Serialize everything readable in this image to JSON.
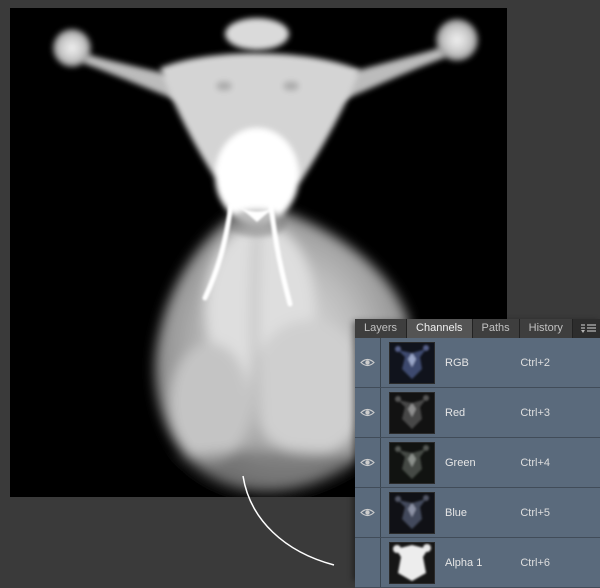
{
  "panel": {
    "tabs": [
      {
        "label": "Layers"
      },
      {
        "label": "Channels"
      },
      {
        "label": "Paths"
      },
      {
        "label": "History"
      }
    ],
    "active_tab": "Channels",
    "channels": [
      {
        "name": "RGB",
        "shortcut": "Ctrl+2",
        "visible": true,
        "selected": true
      },
      {
        "name": "Red",
        "shortcut": "Ctrl+3",
        "visible": true,
        "selected": true
      },
      {
        "name": "Green",
        "shortcut": "Ctrl+4",
        "visible": true,
        "selected": true
      },
      {
        "name": "Blue",
        "shortcut": "Ctrl+5",
        "visible": true,
        "selected": true
      },
      {
        "name": "Alpha 1",
        "shortcut": "Ctrl+6",
        "visible": false,
        "selected": true
      }
    ]
  },
  "canvas": {
    "image_alt": "Grayscale depth-map render of a horned creature on a black background"
  },
  "colors": {
    "workspace_bg": "#3a3a3a",
    "canvas_bg": "#000000",
    "panel_bg": "#535353",
    "tabbar_bg": "#282828",
    "selected_row": "#5a6a7c",
    "text": "#e6e6e6",
    "annotation": "#ffffff"
  }
}
